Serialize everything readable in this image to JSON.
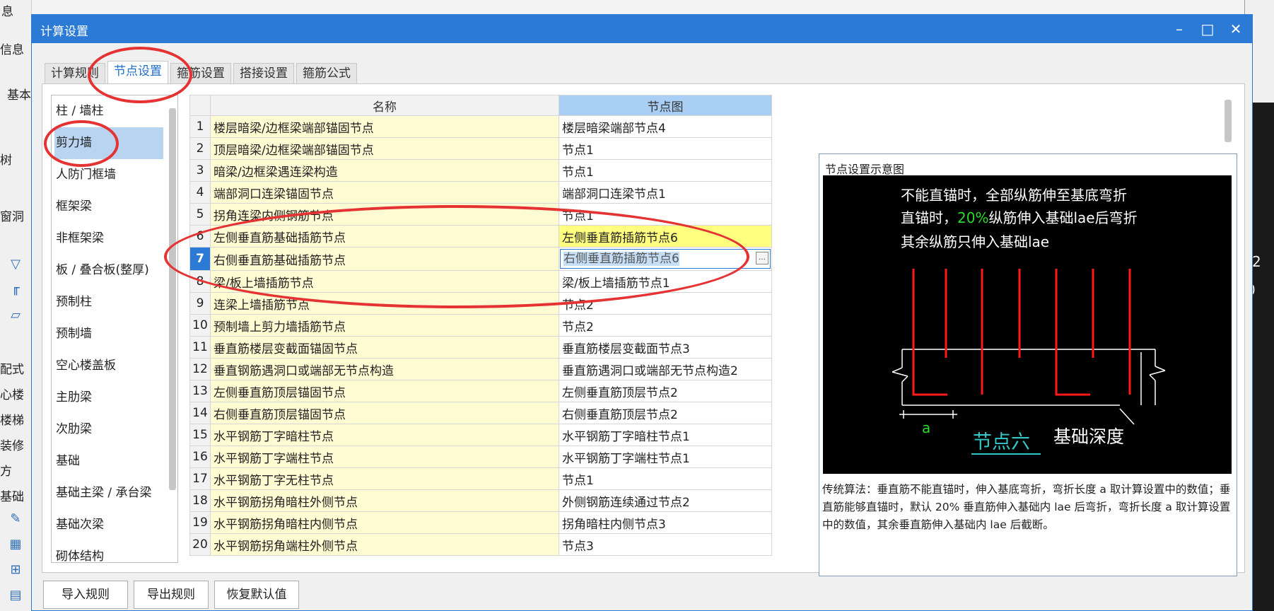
{
  "app": {
    "left_fragments": [
      "息",
      "信息",
      "基本",
      "树",
      "窗洞",
      "配式",
      "心楼",
      "楼梯",
      "装修",
      "方",
      "基础"
    ],
    "right_fragments": [
      "2",
      "0"
    ]
  },
  "dialog": {
    "title": "计算设置",
    "controls": {
      "minimize": "–",
      "maximize": "□",
      "close": "✕"
    },
    "tabs": [
      "计算规则",
      "节点设置",
      "箍筋设置",
      "搭接设置",
      "箍筋公式"
    ],
    "active_tab": 1
  },
  "categories": {
    "items": [
      "柱 / 墙柱",
      "剪力墙",
      "人防门框墙",
      "框架梁",
      "非框架梁",
      "板 / 叠合板(整厚)",
      "预制柱",
      "预制墙",
      "空心楼盖板",
      "主肋梁",
      "次肋梁",
      "基础",
      "基础主梁 / 承台梁",
      "基础次梁",
      "砌体结构"
    ],
    "selected_index": 1
  },
  "table": {
    "headers": {
      "name": "名称",
      "node": "节点图"
    },
    "rows": [
      {
        "num": "1",
        "name": "楼层暗梁/边框梁端部锚固节点",
        "node": "楼层暗梁端部节点4"
      },
      {
        "num": "2",
        "name": "顶层暗梁/边框梁端部锚固节点",
        "node": "节点1"
      },
      {
        "num": "3",
        "name": "暗梁/边框梁遇连梁构造",
        "node": "节点1"
      },
      {
        "num": "4",
        "name": "端部洞口连梁锚固节点",
        "node": "端部洞口连梁节点1"
      },
      {
        "num": "5",
        "name": "拐角连梁内侧钢筋节点",
        "node": "节点1"
      },
      {
        "num": "6",
        "name": "左侧垂直筋基础插筋节点",
        "node": "左侧垂直筋插筋节点6"
      },
      {
        "num": "7",
        "name": "右侧垂直筋基础插筋节点",
        "node": "右侧垂直筋插筋节点6"
      },
      {
        "num": "8",
        "name": "梁/板上墙插筋节点",
        "node": "梁/板上墙插筋节点1"
      },
      {
        "num": "9",
        "name": "连梁上墙插筋节点",
        "node": "节点2"
      },
      {
        "num": "10",
        "name": "预制墙上剪力墙插筋节点",
        "node": "节点2"
      },
      {
        "num": "11",
        "name": "垂直筋楼层变截面锚固节点",
        "node": "垂直筋楼层变截面节点3"
      },
      {
        "num": "12",
        "name": "垂直钢筋遇洞口或端部无节点构造",
        "node": "垂直筋遇洞口或端部无节点构造2"
      },
      {
        "num": "13",
        "name": "左侧垂直筋顶层锚固节点",
        "node": "左侧垂直筋顶层节点2"
      },
      {
        "num": "14",
        "name": "右侧垂直筋顶层锚固节点",
        "node": "右侧垂直筋顶层节点2"
      },
      {
        "num": "15",
        "name": "水平钢筋丁字暗柱节点",
        "node": "水平钢筋丁字暗柱节点1"
      },
      {
        "num": "16",
        "name": "水平钢筋丁字端柱节点",
        "node": "水平钢筋丁字端柱节点1"
      },
      {
        "num": "17",
        "name": "水平钢筋丁字无柱节点",
        "node": "节点1"
      },
      {
        "num": "18",
        "name": "水平钢筋拐角暗柱外侧节点",
        "node": "外侧钢筋连续通过节点2"
      },
      {
        "num": "19",
        "name": "水平钢筋拐角暗柱内侧节点",
        "node": "拐角暗柱内侧节点3"
      },
      {
        "num": "20",
        "name": "水平钢筋拐角端柱外侧节点",
        "node": "节点3"
      }
    ],
    "highlighted_row": 5,
    "current_row": 6,
    "current_cell_dropdown": "…"
  },
  "diagram": {
    "title": "节点设置示意图",
    "line1": "不能直锚时，全部纵筋伸至基底弯折",
    "line2_pre": "直锚时，",
    "line2_pct": "20%",
    "line2_post": "纵筋伸入基础lae后弯折",
    "line3": "其余纵筋只伸入基础lae",
    "label_a": "a",
    "node_label": "节点六",
    "depth_label": "基础深度",
    "description": "传统算法：垂直筋不能直锚时，伸入基底弯折，弯折长度 a 取计算设置中的数值；垂直筋能够直锚时，默认 20% 垂直筋伸入基础内 lae 后弯折，弯折长度 a 取计算设置中的数值，其余垂直筋伸入基础内 lae 后截断。",
    "colors": {
      "background": "#000000",
      "text": "#ffffff",
      "rebar": "#ff1a1a",
      "dim": "#ffffff",
      "accent_green": "#2bd92b",
      "node_label": "#35c7c7"
    }
  },
  "buttons": {
    "import": "导入规则",
    "export": "导出规则",
    "restore": "恢复默认值"
  },
  "annotation_color": "#e53333"
}
